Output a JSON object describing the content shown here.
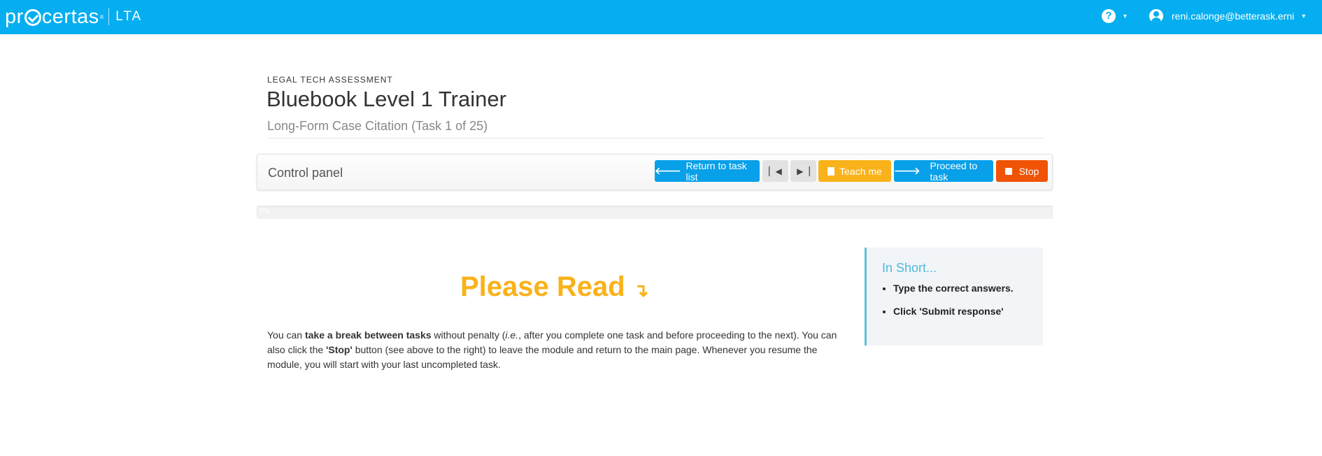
{
  "nav": {
    "logo_text_left": "pr",
    "logo_text_right": "certas",
    "logo_tm": "®",
    "logo_product": "LTA",
    "help_icon": "question-circle-icon",
    "user_email": "reni.calonge@betterask.erni"
  },
  "header": {
    "kicker": "LEGAL TECH ASSESSMENT",
    "title": "Bluebook Level 1 Trainer",
    "subtitle": "Long-Form Case Citation (Task 1 of 25)"
  },
  "control_panel": {
    "label": "Control panel",
    "return_label": "Return to task list",
    "teach_label": "Teach me",
    "proceed_label": "Proceed to task",
    "stop_label": "Stop"
  },
  "progress": {
    "value": 0,
    "text": "0%"
  },
  "content": {
    "heading": "Please Read",
    "p1_a": "You can ",
    "p1_b": "take a break between tasks",
    "p1_c": " without penalty (",
    "p1_d": "i.e.",
    "p1_e": ", after you complete one task and before proceeding to the next). You can also click the ",
    "p1_f": "'Stop'",
    "p1_g": " button (see above to the right) to leave the module and return to the main page. Whenever you resume the module, you will start with your last uncompleted task."
  },
  "sidebar": {
    "title": "In Short...",
    "items": [
      "Type the correct answers.",
      "Click 'Submit response'"
    ]
  },
  "colors": {
    "nav_bg": "#04aef0",
    "blue_button": "#08a0e8",
    "yellow": "#f9b21a",
    "orange": "#f05305"
  }
}
